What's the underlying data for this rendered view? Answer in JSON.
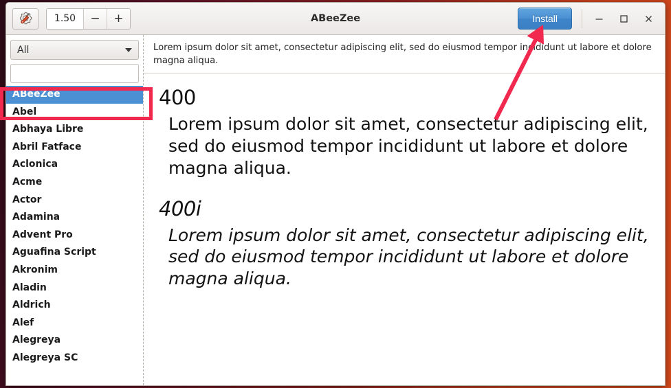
{
  "window": {
    "title": "ABeeZee",
    "controls": {
      "minimize": "—",
      "maximize": "□",
      "close": "×"
    }
  },
  "toolbar": {
    "preferences_icon": "wrench-gear-icon",
    "zoom_value": "1.50",
    "zoom_decrease_label": "−",
    "zoom_increase_label": "+",
    "install_label": "Install"
  },
  "sidebar": {
    "category": {
      "selected": "All",
      "caret_icon": "chevron-down-icon"
    },
    "search": {
      "icon": "search-icon",
      "value": "",
      "placeholder": ""
    },
    "fonts": [
      {
        "name": "ABeeZee",
        "selected": true
      },
      {
        "name": "Abel",
        "selected": false
      },
      {
        "name": "Abhaya Libre",
        "selected": false
      },
      {
        "name": "Abril Fatface",
        "selected": false
      },
      {
        "name": "Aclonica",
        "selected": false
      },
      {
        "name": "Acme",
        "selected": false
      },
      {
        "name": "Actor",
        "selected": false
      },
      {
        "name": "Adamina",
        "selected": false
      },
      {
        "name": "Advent Pro",
        "selected": false
      },
      {
        "name": "Aguafina Script",
        "selected": false
      },
      {
        "name": "Akronim",
        "selected": false
      },
      {
        "name": "Aladin",
        "selected": false
      },
      {
        "name": "Aldrich",
        "selected": false
      },
      {
        "name": "Alef",
        "selected": false
      },
      {
        "name": "Alegreya",
        "selected": false
      },
      {
        "name": "Alegreya SC",
        "selected": false
      }
    ]
  },
  "main": {
    "preview_header_text": "Lorem ipsum dolor sit amet, consectetur adipiscing elit, sed do eiusmod tempor incididunt ut labore et dolore magna aliqua.",
    "styles": [
      {
        "weight_label": "400",
        "italic": false,
        "sample": "Lorem ipsum dolor sit amet, consectetur adipiscing elit, sed do eiusmod tempor incididunt ut labore et dolore magna aliqua."
      },
      {
        "weight_label": "400i",
        "italic": true,
        "sample": "Lorem ipsum dolor sit amet, consectetur adipiscing elit, sed do eiusmod tempor incididunt ut labore et dolore magna aliqua."
      }
    ]
  },
  "annotations": {
    "highlight_color": "#f2294f",
    "arrow_color": "#f2294f",
    "highlight_target": "font-list-item-abeezee",
    "arrow_target": "install-button"
  },
  "colors": {
    "accent_blue": "#4a90d2",
    "selection_blue": "#4a90d2",
    "annotation_red": "#f2294f",
    "window_chrome": "#f6f5f4",
    "desktop_background": "#8e2320"
  }
}
